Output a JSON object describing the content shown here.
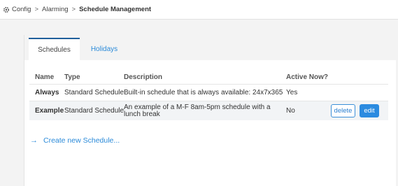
{
  "breadcrumb": {
    "icon": "gear-icon",
    "items": [
      "Config",
      "Alarming",
      "Schedule Management"
    ],
    "separator": ">"
  },
  "tabs": [
    {
      "label": "Schedules",
      "active": true
    },
    {
      "label": "Holidays",
      "active": false
    }
  ],
  "table": {
    "headers": [
      "Name",
      "Type",
      "Description",
      "Active Now?"
    ],
    "rows": [
      {
        "name": "Always",
        "type": "Standard Schedule",
        "description": "Built-in schedule that is always available: 24x7x365",
        "active": "Yes"
      },
      {
        "name": "Example",
        "type": "Standard Schedule",
        "description": "An example of a M-F 8am-5pm schedule with a lunch break",
        "active": "No"
      }
    ]
  },
  "actions": {
    "delete_label": "delete",
    "edit_label": "edit"
  },
  "create_link": {
    "label": "Create new Schedule...",
    "icon": "arrow-right-icon"
  },
  "colors": {
    "accent": "#2b8be0",
    "link": "#2a8ad9",
    "tab_border": "#1f5f9b"
  }
}
